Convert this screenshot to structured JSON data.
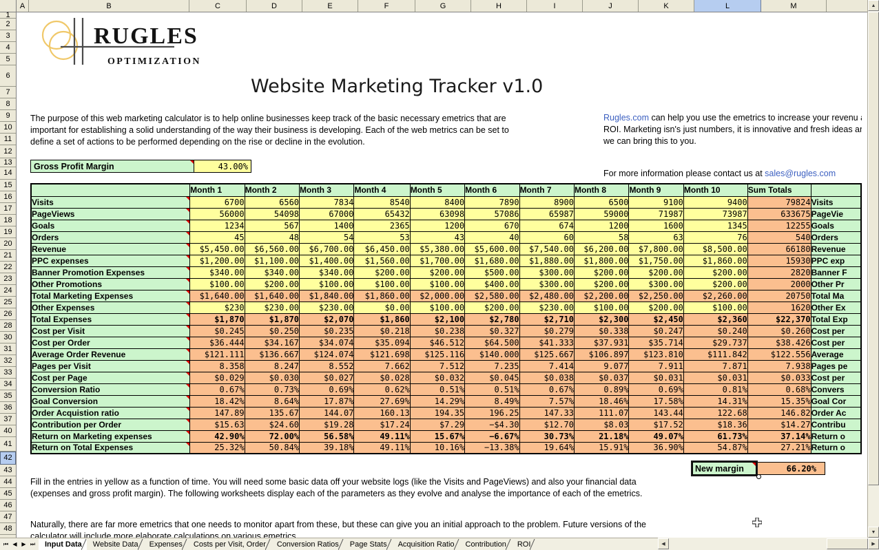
{
  "spreadsheet": {
    "columns": [
      "A",
      "B",
      "C",
      "D",
      "E",
      "F",
      "G",
      "H",
      "I",
      "J",
      "K",
      "L",
      "M"
    ],
    "selected_column": "L",
    "selected_row": "42",
    "rows": [
      "1",
      "2",
      "3",
      "4",
      "5",
      "6",
      "7",
      "8",
      "9",
      "10",
      "11",
      "12",
      "13",
      "14",
      "15",
      "16",
      "17",
      "18",
      "19",
      "20",
      "21",
      "22",
      "23",
      "24",
      "25",
      "26",
      "28",
      "30",
      "31",
      "32",
      "33",
      "34",
      "35",
      "36",
      "37",
      "40",
      "41",
      "42",
      "43",
      "44",
      "45",
      "46",
      "47",
      "48"
    ]
  },
  "logo": {
    "wordmark": "RUGLES",
    "tagline": "OPTIMIZATION",
    "circle_color": "#f0c869",
    "rule_color": "#4a4a4a"
  },
  "title": "Website Marketing Tracker v1.0",
  "intro_left": "The purpose of this web marketing calculator is to help online businesses keep track of the basic necessary emetrics that are important for establishing a solid understanding of the way their business is developing. Each of the web metrics can be set to define a set of actions to be performed depending on the rise or decline in the evolution.",
  "intro_right": {
    "link": "Rugles.com",
    "body": " can help you use the emetrics to increase your revenu and ROI. Marketing isn's just numbers, it is innovative and fresh ideas and we can bring this to you.",
    "contact_prefix": "For more information please contact us at ",
    "contact_email": "sales@rugles.com"
  },
  "gross_profit_margin": {
    "label": "Gross Profit Margin",
    "value": "43.00%"
  },
  "new_margin": {
    "label": "New margin",
    "value": "66.20%"
  },
  "bottom_text_1": "Fill in the entries in yellow as a function of time. You will need some basic data off your website logs (like the Visits and PageViews) and also your financial data (expenses and gross profit margin). The following worksheets display each of the parameters as they evolve and analyse the importance of each of the emetrics.",
  "bottom_text_2": "Naturally, there are far more emetrics that one needs to monitor apart from these, but these can give you an initial approach to the problem. Future versions of the calculator will include more elaborate calculations on various emetrics.",
  "table": {
    "headers": [
      "",
      "Month 1",
      "Month 2",
      "Month 3",
      "Month 4",
      "Month 5",
      "Month 6",
      "Month 7",
      "Month 8",
      "Month 9",
      "Month 10",
      "Sum Totals",
      ""
    ],
    "rows": [
      {
        "label": "Visits",
        "kind": "in",
        "values": [
          "6700",
          "6560",
          "7834",
          "8540",
          "8400",
          "7890",
          "8900",
          "6500",
          "9100",
          "9400"
        ],
        "total": "79824",
        "right": "Visits"
      },
      {
        "label": "PageViews",
        "kind": "in",
        "values": [
          "56000",
          "54098",
          "67000",
          "65432",
          "63098",
          "57086",
          "65987",
          "59000",
          "71987",
          "73987"
        ],
        "total": "633675",
        "right": "PageVie"
      },
      {
        "label": "Goals",
        "kind": "in",
        "values": [
          "1234",
          "567",
          "1400",
          "2365",
          "1200",
          "670",
          "674",
          "1200",
          "1600",
          "1345"
        ],
        "total": "12255",
        "right": "Goals"
      },
      {
        "label": "Orders",
        "kind": "in",
        "values": [
          "45",
          "48",
          "54",
          "53",
          "43",
          "40",
          "60",
          "58",
          "63",
          "76"
        ],
        "total": "540",
        "right": "Orders"
      },
      {
        "label": "Revenue",
        "kind": "in",
        "values": [
          "$5,450.00",
          "$6,560.00",
          "$6,700.00",
          "$6,450.00",
          "$5,380.00",
          "$5,600.00",
          "$7,540.00",
          "$6,200.00",
          "$7,800.00",
          "$8,500.00"
        ],
        "total": "66180",
        "right": "Revenue"
      },
      {
        "label": "PPC expenses",
        "kind": "in",
        "values": [
          "$1,200.00",
          "$1,100.00",
          "$1,400.00",
          "$1,560.00",
          "$1,700.00",
          "$1,680.00",
          "$1,880.00",
          "$1,800.00",
          "$1,750.00",
          "$1,860.00"
        ],
        "total": "15930",
        "right": "PPC exp"
      },
      {
        "label": "Banner Promotion Expenses",
        "kind": "in",
        "values": [
          "$340.00",
          "$340.00",
          "$340.00",
          "$200.00",
          "$200.00",
          "$500.00",
          "$300.00",
          "$200.00",
          "$200.00",
          "$200.00"
        ],
        "total": "2820",
        "right": "Banner F"
      },
      {
        "label": "Other Promotions",
        "kind": "in",
        "values": [
          "$100.00",
          "$200.00",
          "$100.00",
          "$100.00",
          "$100.00",
          "$400.00",
          "$300.00",
          "$200.00",
          "$300.00",
          "$200.00"
        ],
        "total": "2000",
        "right": "Other Pr"
      },
      {
        "label": "Total Marketing Expenses",
        "kind": "calc",
        "values": [
          "$1,640.00",
          "$1,640.00",
          "$1,840.00",
          "$1,860.00",
          "$2,000.00",
          "$2,580.00",
          "$2,480.00",
          "$2,200.00",
          "$2,250.00",
          "$2,260.00"
        ],
        "total": "20750",
        "right": "Total Ma"
      },
      {
        "label": "Other Expenses",
        "kind": "in",
        "values": [
          "$230",
          "$230.00",
          "$230.00",
          "$0.00",
          "$100.00",
          "$200.00",
          "$230.00",
          "$100.00",
          "$200.00",
          "$100.00"
        ],
        "total": "1620",
        "right": "Other Ex"
      },
      {
        "label": "Total Expenses",
        "kind": "calc",
        "bold": true,
        "values": [
          "$1,870",
          "$1,870",
          "$2,070",
          "$1,860",
          "$2,100",
          "$2,780",
          "$2,710",
          "$2,300",
          "$2,450",
          "$2,360"
        ],
        "total": "$22,370",
        "right": "Total Exp"
      },
      {
        "label": "Cost per Visit",
        "kind": "calc",
        "values": [
          "$0.245",
          "$0.250",
          "$0.235",
          "$0.218",
          "$0.238",
          "$0.327",
          "$0.279",
          "$0.338",
          "$0.247",
          "$0.240"
        ],
        "total": "$0.260",
        "right": "Cost per"
      },
      {
        "label": "Cost per Order",
        "kind": "calc",
        "values": [
          "$36.444",
          "$34.167",
          "$34.074",
          "$35.094",
          "$46.512",
          "$64.500",
          "$41.333",
          "$37.931",
          "$35.714",
          "$29.737"
        ],
        "total": "$38.426",
        "right": "Cost per"
      },
      {
        "label": "Average Order Revenue",
        "kind": "calc",
        "values": [
          "$121.111",
          "$136.667",
          "$124.074",
          "$121.698",
          "$125.116",
          "$140.000",
          "$125.667",
          "$106.897",
          "$123.810",
          "$111.842"
        ],
        "total": "$122.556",
        "right": "Average"
      },
      {
        "label": "Pages per Visit",
        "kind": "calc",
        "values": [
          "8.358",
          "8.247",
          "8.552",
          "7.662",
          "7.512",
          "7.235",
          "7.414",
          "9.077",
          "7.911",
          "7.871"
        ],
        "total": "7.938",
        "right": "Pages pe"
      },
      {
        "label": "Cost per Page",
        "kind": "calc",
        "values": [
          "$0.029",
          "$0.030",
          "$0.027",
          "$0.028",
          "$0.032",
          "$0.045",
          "$0.038",
          "$0.037",
          "$0.031",
          "$0.031"
        ],
        "total": "$0.033",
        "right": "Cost per"
      },
      {
        "label": "Conversion Ratio",
        "kind": "calc",
        "values": [
          "0.67%",
          "0.73%",
          "0.69%",
          "0.62%",
          "0.51%",
          "0.51%",
          "0.67%",
          "0.89%",
          "0.69%",
          "0.81%"
        ],
        "total": "0.68%",
        "right": "Convers"
      },
      {
        "label": "Goal Conversion",
        "kind": "calc",
        "values": [
          "18.42%",
          "8.64%",
          "17.87%",
          "27.69%",
          "14.29%",
          "8.49%",
          "7.57%",
          "18.46%",
          "17.58%",
          "14.31%"
        ],
        "total": "15.35%",
        "right": "Goal Cor"
      },
      {
        "label": "Order Acquistion ratio",
        "kind": "calc",
        "values": [
          "147.89",
          "135.67",
          "144.07",
          "160.13",
          "194.35",
          "196.25",
          "147.33",
          "111.07",
          "143.44",
          "122.68"
        ],
        "total": "146.82",
        "right": "Order Ac"
      },
      {
        "label": "Contribution per Order",
        "kind": "calc",
        "values": [
          "$15.63",
          "$24.60",
          "$19.28",
          "$17.24",
          "$7.29",
          "−$4.30",
          "$12.70",
          "$8.03",
          "$17.52",
          "$18.36"
        ],
        "total": "$14.27",
        "right": "Contribu"
      },
      {
        "label": "Return on Marketing expenses",
        "kind": "calc",
        "bold": true,
        "values": [
          "42.90%",
          "72.00%",
          "56.58%",
          "49.11%",
          "15.67%",
          "−6.67%",
          "30.73%",
          "21.18%",
          "49.07%",
          "61.73%"
        ],
        "total": "37.14%",
        "right": "Return o"
      },
      {
        "label": "Return on Total Expenses",
        "kind": "calc",
        "values": [
          "25.32%",
          "50.84%",
          "39.18%",
          "49.11%",
          "10.16%",
          "−13.38%",
          "19.64%",
          "15.91%",
          "36.90%",
          "54.87%"
        ],
        "total": "27.21%",
        "right": "Return o"
      }
    ]
  },
  "sheet_tabs": [
    {
      "label": "Input Data",
      "active": true
    },
    {
      "label": "Website Data",
      "active": false
    },
    {
      "label": "Expenses",
      "active": false
    },
    {
      "label": "Costs per Visit, Order",
      "active": false
    },
    {
      "label": "Conversion Ratios",
      "active": false
    },
    {
      "label": "Page Stats",
      "active": false
    },
    {
      "label": "Acquisition Ratio",
      "active": false
    },
    {
      "label": "Contribution",
      "active": false
    },
    {
      "label": "ROI",
      "active": false
    }
  ],
  "nav_buttons": [
    "⏮",
    "◀",
    "▶",
    "⏭"
  ],
  "colors": {
    "input_yellow": "#ffff9e",
    "calc_orange": "#fbbf8f",
    "label_green": "#ccf5cc",
    "link_blue": "#3b5fc0",
    "header_gray": "#ece9d8",
    "selected_blue": "#b6cdf0"
  }
}
